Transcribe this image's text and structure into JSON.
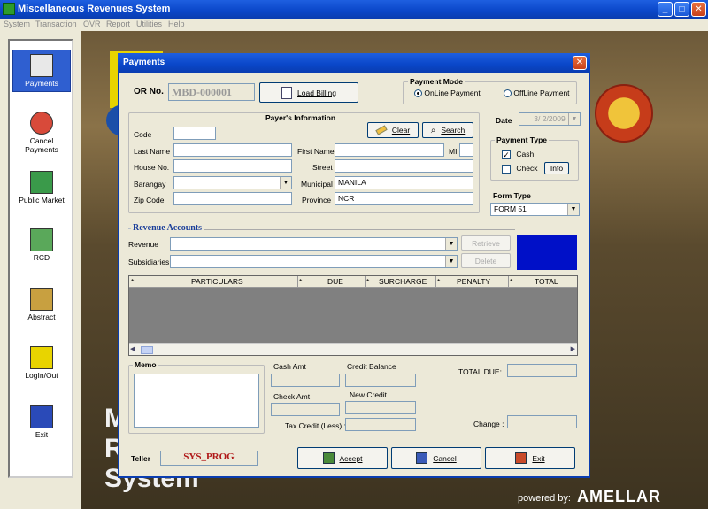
{
  "window": {
    "title": "Miscellaneous Revenues System",
    "controls": {
      "minimize": "_",
      "maximize": "□",
      "close": "✕"
    }
  },
  "menu": [
    "System",
    "Transaction",
    "OVR",
    "Report",
    "Utilities",
    "Help"
  ],
  "nav": [
    {
      "label": "Payments",
      "icon": "payments-icon"
    },
    {
      "label": "Cancel Payments",
      "icon": "cancel-payments-icon"
    },
    {
      "label": "Public Market",
      "icon": "public-market-icon"
    },
    {
      "label": "RCD",
      "icon": "rcd-icon"
    },
    {
      "label": "Abstract",
      "icon": "abstract-icon"
    },
    {
      "label": "LogIn/Out",
      "icon": "login-icon"
    },
    {
      "label": "Exit",
      "icon": "exit-icon"
    }
  ],
  "background": {
    "lines": [
      "M",
      "R",
      "System"
    ],
    "powered_by": "powered by:",
    "brand": "AMELLAR"
  },
  "dialog": {
    "title": "Payments",
    "close": "✕",
    "or_label": "OR No.",
    "or_value": "MBD-000001",
    "load_billing": "Load Billing",
    "payment_mode": {
      "title": "Payment Mode",
      "online": "OnLine Payment",
      "offline": "OffLine Payment",
      "selected": "online"
    },
    "payer": {
      "title": "Payer's Information",
      "code_label": "Code",
      "clear": "Clear",
      "search": "Search",
      "last_name_label": "Last Name",
      "first_name_label": "First Name",
      "mi_label": "MI",
      "house_no_label": "House No.",
      "street_label": "Street",
      "barangay_label": "Barangay",
      "municipal_label": "Municipal",
      "municipal_value": "MANILA",
      "zip_label": "Zip Code",
      "province_label": "Province",
      "province_value": "NCR"
    },
    "date_label": "Date",
    "date_value": "3/ 2/2009",
    "payment_type": {
      "title": "Payment Type",
      "cash": "Cash",
      "cash_checked": true,
      "check": "Check",
      "check_checked": false,
      "info": "Info"
    },
    "form_type_label": "Form Type",
    "form_type_value": "FORM 51",
    "revenue_accounts": {
      "title": "Revenue Accounts",
      "revenue_label": "Revenue",
      "subsidiaries_label": "Subsidiaries",
      "retrieve": "Retrieve",
      "delete": "Delete"
    },
    "grid_columns": [
      "PARTICULARS",
      "DUE",
      "SURCHARGE",
      "PENALTY",
      "TOTAL"
    ],
    "grid_marker": "*",
    "memo_label": "Memo",
    "cash_amt_label": "Cash Amt",
    "credit_balance_label": "Credit Balance",
    "check_amt_label": "Check Amt",
    "new_credit_label": "New Credit",
    "tax_credit_label": "Tax Credit (Less) :",
    "total_due_label": "TOTAL DUE:",
    "change_label": "Change :",
    "teller_label": "Teller",
    "teller_value": "SYS_PROG",
    "accept": "Accept",
    "cancel": "Cancel",
    "exit": "Exit"
  },
  "colors": {
    "titlebar": "#0a46c8",
    "dialog_bg": "#ece9d8",
    "grid_bg": "#808080",
    "teller_text": "#b01818",
    "color_swatch": "#0010c8",
    "section_title": "#1a3e9a"
  }
}
